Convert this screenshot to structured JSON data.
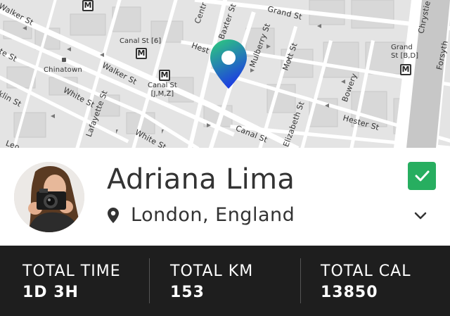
{
  "map": {
    "streets": {
      "walker_st_1": "Walker St",
      "walker_st_2": "Walker St",
      "canal_st_label": "Canal St [6]",
      "canal_st_jmz": "Canal St\n[J,M,Z]",
      "canal_st_main": "Canal St",
      "chinatown": "Chinatown",
      "white_st_1": "White St",
      "white_st_2": "White St",
      "lafayette_st": "Lafayette St",
      "baxter_st": "Baxter St",
      "centre_st": "Centr",
      "hester_st_1": "Hest",
      "hester_st_2": "Hester St",
      "mulberry_st": "Mulberry St",
      "mott_st": "Mott St",
      "grand_st_1": "Grand St",
      "grand_st_2": "Grand\nSt [B,D]",
      "bowery": "Bowery",
      "elizabeth_st": "Elizabeth St",
      "forsyth_st": "Forsyth",
      "chrystie_st": "Chrystie",
      "st_left_1": "Walker St",
      "kln_st": "klin St",
      "te_st": "te St",
      "leo": "Leo"
    },
    "metro_icon": "M",
    "marker_icon": "map-pin-icon"
  },
  "profile": {
    "name": "Adriana Lima",
    "location": "London, England",
    "avatar_icon": "avatar",
    "check_icon": "check-icon",
    "expand_icon": "chevron-down-icon"
  },
  "stats": [
    {
      "label": "TOTAL TIME",
      "value": "1D 3H"
    },
    {
      "label": "TOTAL KM",
      "value": "153"
    },
    {
      "label": "TOTAL CAL",
      "value": "13850"
    }
  ],
  "colors": {
    "accent_green": "#27ae60",
    "stats_bg": "#1e1e1e",
    "marker_top": "#29c080",
    "marker_bottom": "#1d4fd8"
  }
}
